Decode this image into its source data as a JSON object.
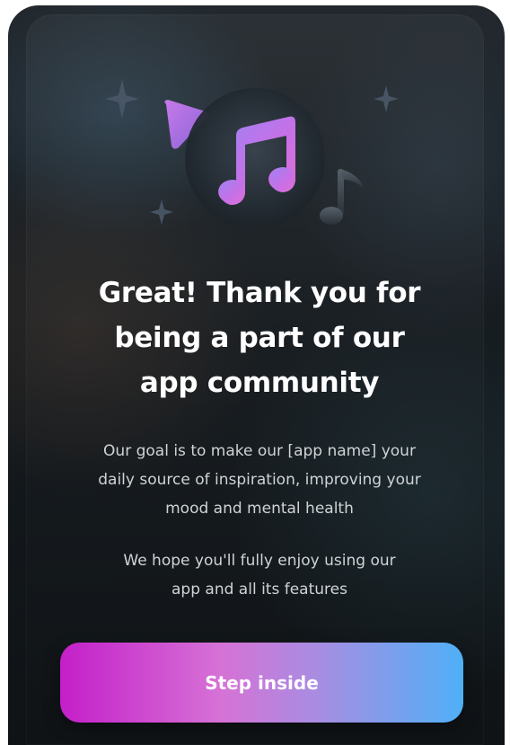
{
  "onboarding": {
    "headline_line1": "Great! Thank you for",
    "headline_line2": "being a part of our",
    "headline_line3": "app community",
    "goal_line1": "Our goal is to make our [app name] your",
    "goal_line2": "daily source of inspiration, improving your",
    "goal_line3": "mood and mental health",
    "hope_line1": "We hope you'll fully enjoy using our",
    "hope_line2": "app and all its features",
    "cta_label": "Step inside"
  },
  "icons": [
    "music-notes-icon",
    "play-triangle-icon",
    "sparkle-icon",
    "music-note-icon"
  ],
  "colors": {
    "background_dark": "#151a1e",
    "text_primary": "#ffffff",
    "text_secondary": "#cfd3d6",
    "gradient_start": "#c41fc9",
    "gradient_mid": "#d672d6",
    "gradient_end": "#4fb0f7"
  }
}
